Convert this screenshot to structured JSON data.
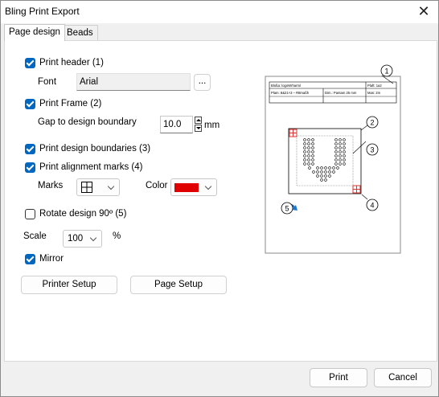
{
  "window": {
    "title": "Bling Print Export"
  },
  "tabs": [
    {
      "label": "Page design"
    },
    {
      "label": "Beads"
    }
  ],
  "options": {
    "print_header": {
      "label": "Print header (1)",
      "checked": true
    },
    "font_label": "Font",
    "font_value": "Arial",
    "font_browse_label": "...",
    "print_frame": {
      "label": "Print Frame (2)",
      "checked": true
    },
    "gap_label": "Gap to design boundary",
    "gap_value": "10.0",
    "gap_unit": "mm",
    "print_design_boundaries": {
      "label": "Print design boundaries (3)",
      "checked": true
    },
    "print_alignment_marks": {
      "label": "Print alignment marks (4)",
      "checked": true
    },
    "marks_label": "Marks",
    "marks_icon": "grid-cross-icon",
    "color_label": "Color",
    "color_value": "#e00000",
    "rotate_design": {
      "label": "Rotate design 90º (5)",
      "checked": false
    },
    "scale_label": "Scale",
    "scale_value": "100",
    "scale_unit": "%",
    "mirror": {
      "label": "Mirror",
      "checked": true
    }
  },
  "buttons": {
    "printer_setup": "Printer Setup",
    "page_setup": "Page Setup",
    "print": "Print",
    "cancel": "Cancel"
  },
  "preview": {
    "header_cells": {
      "r1c1": "Bloßa: logoWrharml",
      "r1c2": "Plaft: 1a2",
      "r2c1": "Plam: 8&21×3 – R8maßh",
      "r2c2": "Dim.: Pantam 25 mm",
      "r2c3": "Mas: 2m"
    },
    "callouts": [
      "1",
      "2",
      "3",
      "4",
      "5"
    ],
    "mark_color": "#e03030",
    "rotate_arrow_color": "#1e78d0"
  }
}
